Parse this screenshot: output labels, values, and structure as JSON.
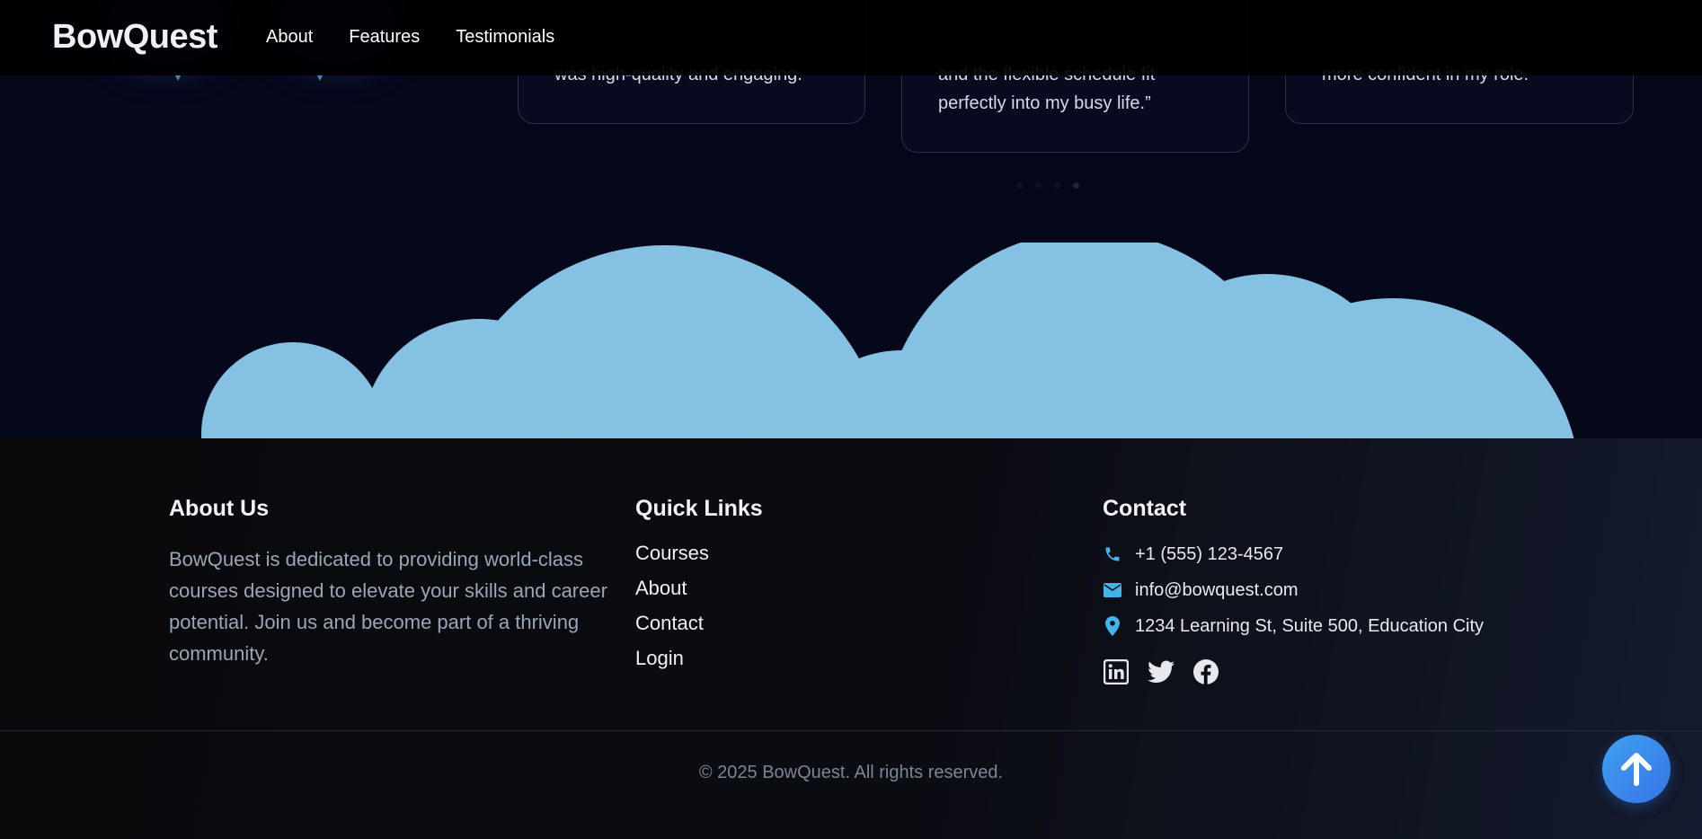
{
  "navbar": {
    "brand": "BowQuest",
    "links": [
      "About",
      "Features",
      "Testimonials"
    ]
  },
  "testimonials": {
    "cards": [
      {
        "lines": [
          "was high-quality and engaging."
        ]
      },
      {
        "lines": [
          "and the flexible schedule fit",
          "perfectly into my busy life.”"
        ]
      },
      {
        "lines": [
          "more confident in my role."
        ]
      }
    ],
    "active_dot": 3
  },
  "colors": {
    "cloud": "#85c1e3",
    "accent_icon": "#45b3e8",
    "scroll_button": "#3b8ef0"
  },
  "footer": {
    "about": {
      "heading": "About Us",
      "text": "BowQuest is dedicated to providing world-class courses designed to elevate your skills and career potential. Join us and become part of a thriving community."
    },
    "quick_links": {
      "heading": "Quick Links",
      "items": [
        "Courses",
        "About",
        "Contact",
        "Login"
      ]
    },
    "contact": {
      "heading": "Contact",
      "phone": "+1 (555) 123-4567",
      "email": "info@bowquest.com",
      "address": "1234 Learning St, Suite 500, Education City",
      "social_icons": [
        "linkedin-icon",
        "twitter-icon",
        "facebook-icon"
      ]
    },
    "copyright": "© 2025 BowQuest. All rights reserved."
  },
  "scroll_top_icon": "arrow-up-icon"
}
